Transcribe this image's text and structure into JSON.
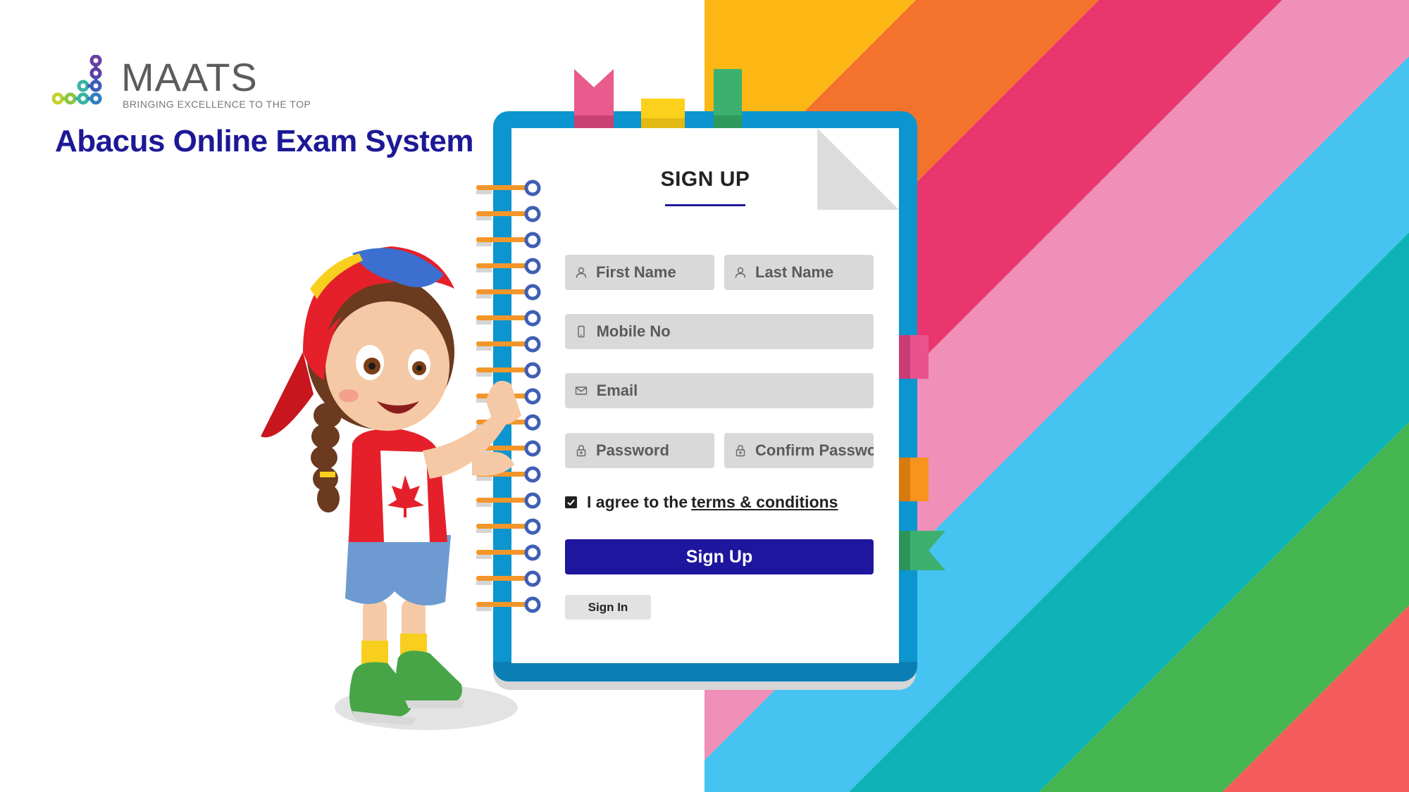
{
  "brand": {
    "logo_name": "MAATS",
    "logo_tagline": "BRINGING EXCELLENCE TO THE TOP",
    "app_title": "Abacus Online Exam System"
  },
  "form": {
    "title": "SIGN UP",
    "first_name": {
      "placeholder": "First Name",
      "icon": "user-icon"
    },
    "last_name": {
      "placeholder": "Last Name",
      "icon": "user-icon"
    },
    "mobile": {
      "placeholder": "Mobile No",
      "icon": "mobile-icon"
    },
    "email": {
      "placeholder": "Email",
      "icon": "envelope-icon"
    },
    "password": {
      "placeholder": "Password",
      "icon": "lock-icon"
    },
    "confirm_password": {
      "placeholder": "Confirm Password",
      "icon": "lock-icon"
    },
    "agree": {
      "checked": true,
      "text": "I agree to the",
      "link": "terms  & conditions"
    },
    "signup_label": "Sign Up",
    "signin_label": "Sign In"
  },
  "colors": {
    "accent": "#1e169e",
    "title": "#1d1896",
    "notebook": "#0c95cf",
    "stripes": [
      "#fdb714",
      "#f3722c",
      "#e9366f",
      "#f08fb8",
      "#45c4f1",
      "#0db2b7",
      "#45b64f",
      "#f45c5b"
    ]
  }
}
